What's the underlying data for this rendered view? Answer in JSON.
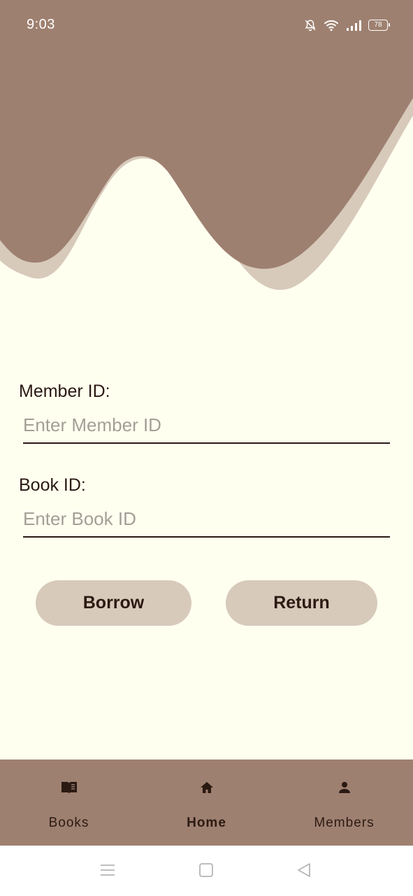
{
  "status_bar": {
    "time": "9:03",
    "battery": "78",
    "icons": [
      "bell-off-icon",
      "wifi-icon",
      "signal-icon",
      "battery-icon"
    ]
  },
  "form": {
    "member_label": "Member ID:",
    "member_placeholder": "Enter Member ID",
    "member_value": "",
    "book_label": "Book ID:",
    "book_placeholder": "Enter Book ID",
    "book_value": ""
  },
  "actions": {
    "borrow_label": "Borrow",
    "return_label": "Return"
  },
  "bottom_nav": {
    "items": [
      {
        "label": "Books",
        "icon": "book-icon",
        "active": false
      },
      {
        "label": "Home",
        "icon": "home-icon",
        "active": true
      },
      {
        "label": "Members",
        "icon": "person-icon",
        "active": false
      }
    ]
  },
  "system_nav": {
    "icons": [
      "menu-icon",
      "home-square-icon",
      "back-triangle-icon"
    ]
  },
  "colors": {
    "background": "#FFFFF0",
    "header_dark": "#9E8070",
    "header_light": "#D7CABB",
    "text": "#2B1A12",
    "button": "#D7CABB",
    "placeholder": "#A39E96"
  }
}
